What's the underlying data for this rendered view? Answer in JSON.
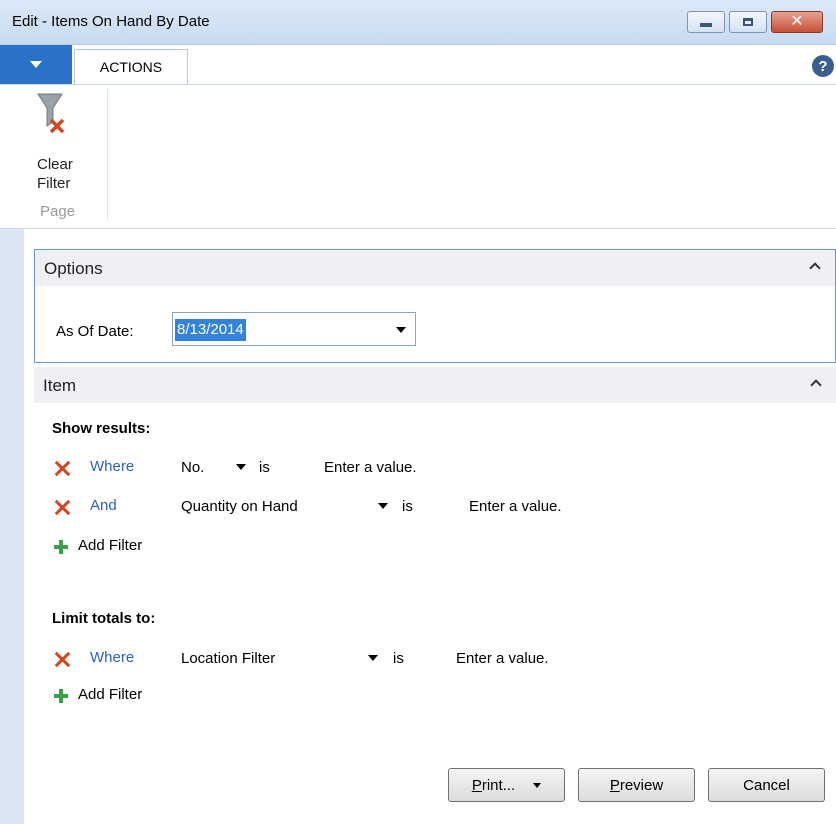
{
  "window": {
    "title": "Edit - Items On Hand By Date"
  },
  "tabs": {
    "actions_label": "ACTIONS",
    "help_glyph": "?"
  },
  "ribbon": {
    "clear_filter_label_1": "Clear",
    "clear_filter_label_2": "Filter",
    "group_label": "Page"
  },
  "options": {
    "header": "Options",
    "as_of_label": "As Of Date:",
    "as_of_value": "8/13/2014"
  },
  "item": {
    "header": "Item",
    "show_results_label": "Show results:",
    "show_filters": [
      {
        "connector": "Where",
        "field": "No.",
        "operator": "is",
        "value": "Enter a value."
      },
      {
        "connector": "And",
        "field": "Quantity on Hand",
        "operator": "is",
        "value": "Enter a value."
      }
    ],
    "add_filter_label": "Add Filter",
    "limit_totals_label": "Limit totals to:",
    "limit_filters": [
      {
        "connector": "Where",
        "field": "Location Filter",
        "operator": "is",
        "value": "Enter a value."
      }
    ],
    "add_filter_label_2": "Add Filter"
  },
  "buttons": {
    "print_label": "Print...",
    "print_mnemonic": "P",
    "print_rest": "rint...",
    "preview_mnemonic": "P",
    "preview_rest": "review",
    "cancel_label": "Cancel"
  },
  "colors": {
    "accent": "#2a71c7",
    "link": "#2a61c9",
    "remove": "#d2451f",
    "add": "#3aa14b",
    "selection": "#3383dc"
  }
}
